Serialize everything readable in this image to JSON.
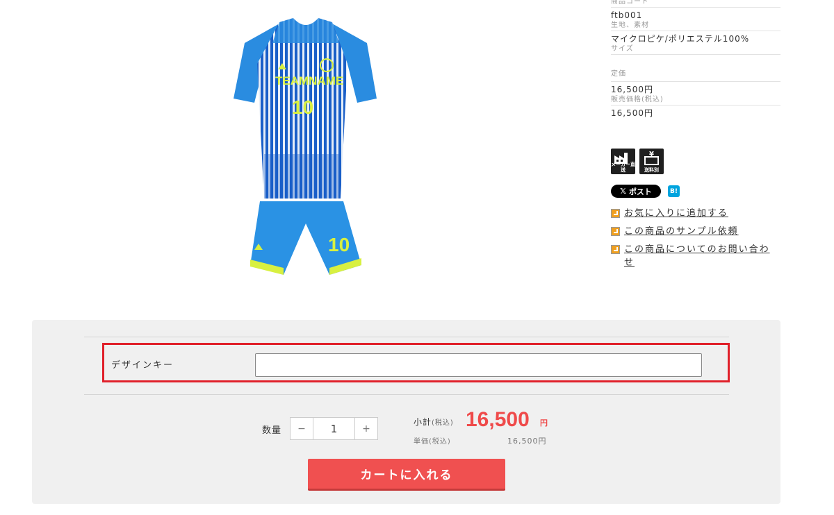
{
  "product": {
    "team_name": "TEAMNAME",
    "number": "10"
  },
  "spec": {
    "code_label": "商品コード",
    "code_value": "ftb001",
    "material_label": "生地、素材",
    "material_value": "マイクロピケ/ポリエステル100%",
    "size_label": "サイズ",
    "list_price_label": "定価",
    "list_price_value": "16,500円",
    "sale_price_label": "販売価格(税込)",
    "sale_price_value": "16,500円"
  },
  "badges": {
    "direct_ship": "メーカー直送",
    "shipping_separate": "送料別"
  },
  "social": {
    "x_post": "ポスト",
    "hatena": "B!"
  },
  "links": {
    "favorite": "お気に入りに追加する",
    "sample": "この商品のサンプル依頼",
    "inquiry": "この商品についてのお問い合わせ"
  },
  "cart": {
    "design_key_label": "デザインキー",
    "design_key_value": "",
    "quantity_label": "数量",
    "quantity_value": "1",
    "minus": "−",
    "plus": "+",
    "subtotal_label": "小計",
    "tax_note": "(税込)",
    "subtotal_value": "16,500",
    "currency": "円",
    "unit_price_label": "単価",
    "unit_price_value": "16,500円",
    "add_to_cart": "カートに入れる"
  },
  "colors": {
    "accent_red": "#ef4a4a",
    "highlight_border": "#e0202a",
    "jersey_blue": "#1e7fd8",
    "jersey_yellow": "#d8f040"
  }
}
